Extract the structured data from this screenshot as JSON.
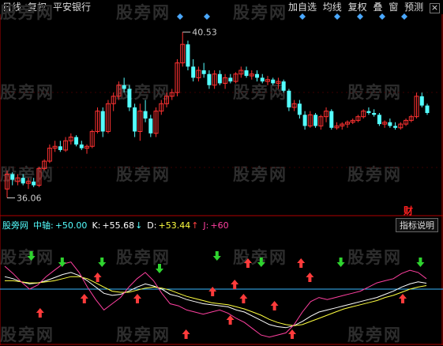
{
  "title": {
    "period": "日线",
    "adjust": "复权",
    "stock": "平安银行"
  },
  "toolbar": {
    "add": "加自选",
    "ma": "均线",
    "adjust": "复权",
    "overlay": "叠",
    "window": "窗",
    "predict": "预测",
    "close": "×"
  },
  "watermark": "股旁网",
  "price": {
    "high": "40.53",
    "low": "36.06"
  },
  "finance_badge": "财",
  "indicator": {
    "name": "股旁网",
    "mid_label": "中轴:",
    "mid_value": "+50.00",
    "k_label": "K:",
    "k_value": "+55.68",
    "k_arrow": "↓",
    "d_label": "D:",
    "d_value": "+53.44",
    "d_arrow": "↑",
    "j_label": "J:",
    "j_value": "+60",
    "help": "指标说明"
  },
  "colors": {
    "up": "#ff3232",
    "down": "#54ffff",
    "axis": "#b00000",
    "signal_up": "#ff3b3b",
    "signal_down": "#2fd42f",
    "k_line": "#ffffff",
    "d_line": "#ffff40",
    "j_line": "#ff40a0",
    "mid_line": "#3ab8ff"
  },
  "chart_data": [
    {
      "type": "candlestick",
      "candles": [
        [
          36.3,
          36.8,
          36.06,
          36.7
        ],
        [
          36.7,
          36.75,
          36.4,
          36.55
        ],
        [
          36.5,
          36.7,
          36.4,
          36.6
        ],
        [
          36.6,
          36.7,
          36.4,
          36.45
        ],
        [
          36.45,
          36.6,
          36.3,
          36.5
        ],
        [
          36.5,
          36.6,
          36.35,
          36.4
        ],
        [
          36.4,
          36.9,
          36.35,
          36.85
        ],
        [
          36.85,
          37.1,
          36.8,
          37.05
        ],
        [
          37.05,
          37.5,
          37.0,
          37.4
        ],
        [
          37.4,
          37.6,
          37.3,
          37.45
        ],
        [
          37.45,
          37.6,
          37.3,
          37.35
        ],
        [
          37.35,
          37.7,
          37.3,
          37.6
        ],
        [
          37.6,
          37.8,
          37.5,
          37.7
        ],
        [
          37.7,
          37.75,
          37.45,
          37.5
        ],
        [
          37.5,
          37.6,
          37.35,
          37.4
        ],
        [
          37.4,
          37.5,
          37.25,
          37.45
        ],
        [
          37.45,
          37.9,
          37.4,
          37.85
        ],
        [
          37.85,
          38.5,
          37.8,
          38.4
        ],
        [
          38.4,
          38.5,
          37.7,
          37.85
        ],
        [
          37.85,
          38.7,
          37.8,
          38.6
        ],
        [
          38.6,
          38.9,
          38.4,
          38.8
        ],
        [
          38.8,
          39.2,
          38.7,
          39.1
        ],
        [
          39.1,
          39.3,
          38.9,
          39.0
        ],
        [
          39.0,
          39.1,
          38.4,
          38.5
        ],
        [
          38.5,
          38.6,
          37.7,
          37.85
        ],
        [
          37.85,
          38.6,
          37.6,
          38.4
        ],
        [
          38.4,
          38.7,
          38.1,
          38.2
        ],
        [
          38.2,
          38.3,
          37.7,
          37.8
        ],
        [
          37.8,
          38.5,
          37.7,
          38.4
        ],
        [
          38.4,
          38.7,
          38.3,
          38.6
        ],
        [
          38.6,
          38.9,
          38.5,
          38.8
        ],
        [
          38.8,
          39.0,
          38.7,
          38.9
        ],
        [
          38.9,
          39.8,
          38.8,
          39.7
        ],
        [
          39.7,
          40.53,
          39.6,
          40.2
        ],
        [
          40.2,
          40.3,
          39.5,
          39.6
        ],
        [
          39.6,
          39.8,
          39.2,
          39.3
        ],
        [
          39.3,
          39.6,
          39.2,
          39.5
        ],
        [
          39.5,
          39.7,
          39.3,
          39.4
        ],
        [
          39.4,
          39.5,
          39.0,
          39.1
        ],
        [
          39.1,
          39.5,
          39.0,
          39.4
        ],
        [
          39.4,
          39.5,
          39.1,
          39.15
        ],
        [
          39.15,
          39.4,
          39.0,
          39.3
        ],
        [
          39.3,
          39.4,
          39.15,
          39.2
        ],
        [
          39.2,
          39.45,
          39.15,
          39.4
        ],
        [
          39.4,
          39.6,
          39.3,
          39.5
        ],
        [
          39.5,
          39.6,
          39.3,
          39.35
        ],
        [
          39.35,
          39.5,
          39.25,
          39.4
        ],
        [
          39.4,
          39.5,
          39.2,
          39.3
        ],
        [
          39.3,
          39.4,
          39.15,
          39.2
        ],
        [
          39.2,
          39.35,
          39.1,
          39.25
        ],
        [
          39.25,
          39.3,
          39.1,
          39.15
        ],
        [
          39.15,
          39.3,
          39.0,
          39.2
        ],
        [
          39.2,
          39.25,
          38.9,
          38.95
        ],
        [
          38.95,
          39.0,
          38.4,
          38.5
        ],
        [
          38.5,
          38.7,
          38.4,
          38.6
        ],
        [
          38.6,
          38.7,
          38.2,
          38.3
        ],
        [
          38.3,
          38.4,
          37.9,
          38.0
        ],
        [
          38.0,
          38.4,
          37.95,
          38.3
        ],
        [
          38.3,
          38.35,
          37.95,
          38.0
        ],
        [
          38.0,
          38.3,
          37.9,
          38.25
        ],
        [
          38.25,
          38.5,
          38.1,
          38.4
        ],
        [
          38.4,
          38.45,
          37.9,
          37.95
        ],
        [
          37.95,
          38.1,
          37.9,
          38.0
        ],
        [
          38.0,
          38.1,
          37.9,
          38.05
        ],
        [
          38.05,
          38.15,
          37.95,
          38.1
        ],
        [
          38.1,
          38.2,
          38.05,
          38.15
        ],
        [
          38.15,
          38.3,
          38.1,
          38.25
        ],
        [
          38.25,
          38.45,
          38.2,
          38.4
        ],
        [
          38.4,
          38.5,
          38.3,
          38.35
        ],
        [
          38.35,
          38.45,
          38.25,
          38.3
        ],
        [
          38.3,
          38.35,
          38.0,
          38.05
        ],
        [
          38.05,
          38.15,
          37.95,
          38.1
        ],
        [
          38.1,
          38.2,
          37.95,
          38.0
        ],
        [
          38.0,
          38.1,
          37.9,
          37.95
        ],
        [
          37.95,
          38.1,
          37.9,
          38.05
        ],
        [
          38.05,
          38.2,
          38.0,
          38.15
        ],
        [
          38.15,
          38.3,
          38.1,
          38.25
        ],
        [
          38.25,
          38.9,
          38.2,
          38.8
        ],
        [
          38.8,
          38.9,
          38.5,
          38.55
        ],
        [
          38.55,
          38.6,
          38.3,
          38.35
        ]
      ],
      "high_label": "40.53",
      "low_label": "36.06"
    },
    {
      "type": "line",
      "mid": 50,
      "series": [
        {
          "name": "K",
          "values": [
            62,
            60,
            57,
            55,
            56,
            58,
            61,
            64,
            66,
            63,
            58,
            52,
            46,
            44,
            45,
            48,
            52,
            55,
            53,
            50,
            45,
            43,
            40,
            38,
            36,
            35,
            34,
            33,
            30,
            28,
            24,
            20,
            16,
            14,
            13,
            15,
            19,
            24,
            28,
            30,
            32,
            34,
            36,
            38,
            40,
            42,
            45,
            48,
            52,
            55,
            57,
            55.68
          ]
        },
        {
          "name": "D",
          "values": [
            58,
            58,
            57,
            56,
            56,
            57,
            58,
            60,
            62,
            62,
            60,
            56,
            52,
            48,
            47,
            47,
            49,
            51,
            52,
            51,
            49,
            46,
            43,
            41,
            39,
            37,
            36,
            35,
            33,
            31,
            28,
            25,
            21,
            18,
            16,
            15,
            16,
            19,
            22,
            25,
            28,
            31,
            33,
            35,
            37,
            39,
            42,
            44,
            47,
            50,
            52,
            53.44
          ]
        },
        {
          "name": "J",
          "values": [
            72,
            65,
            57,
            50,
            54,
            62,
            68,
            74,
            76,
            66,
            52,
            40,
            30,
            36,
            42,
            52,
            60,
            66,
            58,
            46,
            36,
            34,
            30,
            28,
            26,
            28,
            30,
            27,
            22,
            18,
            12,
            6,
            4,
            6,
            8,
            16,
            28,
            38,
            42,
            40,
            42,
            44,
            46,
            48,
            52,
            56,
            58,
            60,
            65,
            68,
            66,
            60
          ]
        }
      ]
    }
  ],
  "signals": {
    "down": [
      6,
      13,
      22,
      35,
      48,
      58,
      76,
      94
    ],
    "up": [
      8,
      18,
      21,
      30,
      41,
      47,
      51,
      52,
      54,
      55,
      61,
      65,
      67,
      69,
      90
    ]
  }
}
